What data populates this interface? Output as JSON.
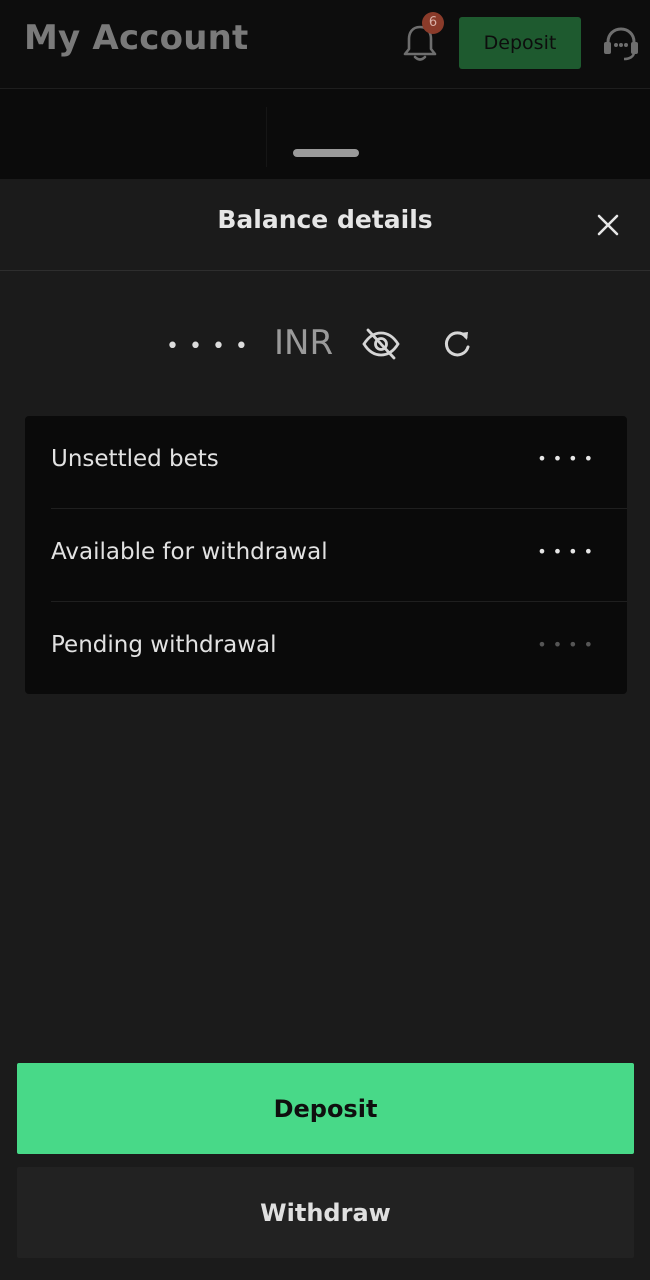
{
  "app_header": {
    "title": "My Account",
    "notification_count": "6",
    "deposit_label": "Deposit",
    "icons": {
      "bell": "bell-icon",
      "support": "headset-support-icon"
    }
  },
  "sheet": {
    "title": "Balance details",
    "close_icon": "close-icon",
    "balance": {
      "masked_value": "••••",
      "currency": "INR",
      "visibility_icon": "eye-off-icon",
      "refresh_icon": "refresh-icon"
    },
    "rows": [
      {
        "label": "Unsettled bets",
        "value": "••••"
      },
      {
        "label": "Available for withdrawal",
        "value": "••••"
      },
      {
        "label": "Pending withdrawal",
        "value": "••••"
      }
    ],
    "actions": {
      "deposit_label": "Deposit",
      "withdraw_label": "Withdraw"
    }
  },
  "colors": {
    "accent": "#48d988",
    "background": "#1b1b1b",
    "card": "#0a0a0a"
  }
}
